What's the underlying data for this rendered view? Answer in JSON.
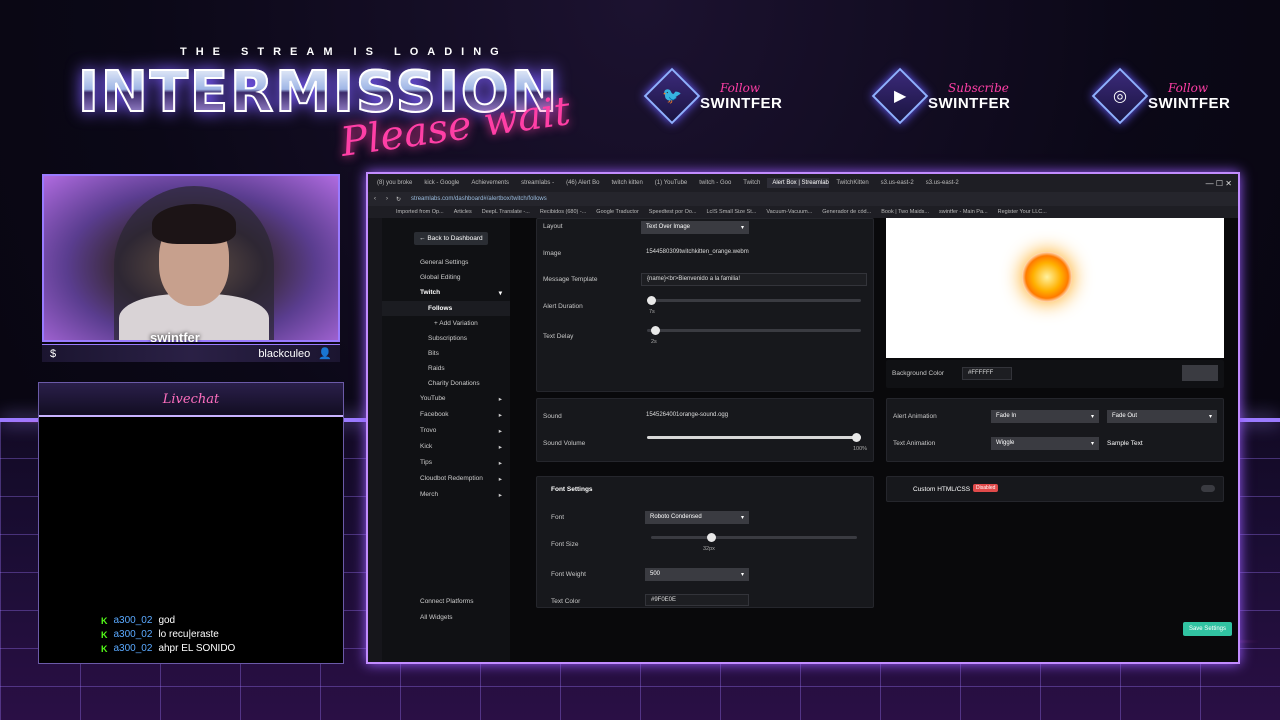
{
  "overlay": {
    "loading_text": "THE STREAM IS LOADING",
    "title": "INTERMISSION",
    "subtitle": "Please wait",
    "socials": [
      {
        "icon": "twitter-icon",
        "action": "Follow",
        "name": "SWINTFER"
      },
      {
        "icon": "youtube-icon",
        "action": "Subscribe",
        "name": "SWINTFER"
      },
      {
        "icon": "instagram-icon",
        "action": "Follow",
        "name": "SWINTFER"
      }
    ],
    "cam_name": "swintfer",
    "cam_bar": {
      "left_icon": "$",
      "right_name": "blackculeo"
    },
    "livechat_title": "Livechat",
    "messages": [
      {
        "user": "a300_02",
        "text": "god"
      },
      {
        "user": "a300_02",
        "text": "lo recu|eraste"
      },
      {
        "user": "a300_02",
        "text": "ahpr EL SONIDO"
      }
    ]
  },
  "browser": {
    "tabs": [
      "(8) you broke",
      "kick - Google",
      "Achievements",
      "streamlabs - ",
      "(46) Alert Bo",
      "twitch kitten",
      "(1) YouTube",
      "twitch - Goo",
      "Twitch",
      "Alert Box | Streamlabs",
      "TwitchKitten",
      "s3.us-east-2",
      "s3.us-east-2"
    ],
    "url": "streamlabs.com/dashboard#/alertbox/twitch/follows",
    "bookmarks": [
      "Imported from Op...",
      "Articles",
      "DeepL Translate -...",
      "Recibidos (680) -...",
      "Google Traductor",
      "Speedtest por Oo...",
      "LcIS Small Size St...",
      "Vacuum-Vacuum...",
      "Generador de cód...",
      "Book | Two Maids...",
      "swintfer - Main Pa...",
      "Register Your LLC..."
    ]
  },
  "nav": {
    "back_label": "Back to Dashboard",
    "items": [
      {
        "label": "General Settings",
        "level": 0
      },
      {
        "label": "Global Editing",
        "level": 0
      },
      {
        "label": "Twitch",
        "level": 0
      },
      {
        "label": "Follows",
        "level": 1
      },
      {
        "label": "Add Variation",
        "level": 2
      },
      {
        "label": "Subscriptions",
        "level": 1
      },
      {
        "label": "Bits",
        "level": 1
      },
      {
        "label": "Raids",
        "level": 1
      },
      {
        "label": "Charity Donations",
        "level": 1
      },
      {
        "label": "YouTube",
        "level": 0
      },
      {
        "label": "Facebook",
        "level": 0
      },
      {
        "label": "Trovo",
        "level": 0
      },
      {
        "label": "Kick",
        "level": 0
      },
      {
        "label": "Tips",
        "level": 0
      },
      {
        "label": "Cloudbot Redemption",
        "level": 0
      },
      {
        "label": "Merch",
        "level": 0
      }
    ],
    "connect_platforms": "Connect Platforms",
    "all_widgets": "All Widgets"
  },
  "form": {
    "layout_label": "Layout",
    "layout_value": "Text Over Image",
    "image_label": "Image",
    "image_value": "1544580309twitchkitten_orange.webm",
    "message_template_label": "Message Template",
    "message_template_value": "{name}<br>Bienvenido a la familia!",
    "alert_duration_label": "Alert Duration",
    "alert_duration_value": "7s",
    "text_delay_label": "Text Delay",
    "text_delay_value": "2s",
    "sound_label": "Sound",
    "sound_value": "1545264001orange-sound.ogg",
    "sound_volume_label": "Sound Volume",
    "sound_volume_value": "100%",
    "font_settings_label": "Font Settings",
    "font_label": "Font",
    "font_value": "Roboto Condensed",
    "font_size_label": "Font Size",
    "font_size_value": "32px",
    "font_weight_label": "Font Weight",
    "font_weight_value": "500",
    "text_color_label": "Text Color",
    "text_color_value": "#9F0E0E",
    "background_color_label": "Background Color",
    "background_color_value": "#FFFFFF",
    "alert_animation_label": "Alert Animation",
    "alert_in_value": "Fade In",
    "alert_out_value": "Fade Out",
    "text_animation_label": "Text Animation",
    "text_animation_value": "Wiggle",
    "sample_text": "Sample Text",
    "custom_html_label": "Custom HTML/CSS",
    "custom_html_badge": "Disabled",
    "save_label": "Save Settings"
  }
}
